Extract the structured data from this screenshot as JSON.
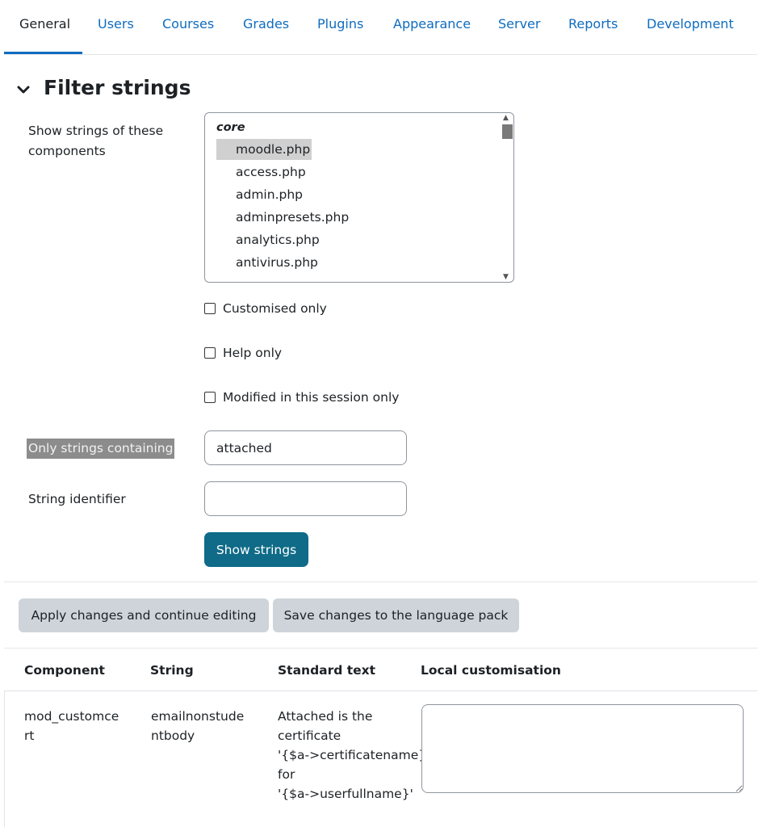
{
  "tabs": [
    {
      "label": "General",
      "active": true
    },
    {
      "label": "Users"
    },
    {
      "label": "Courses"
    },
    {
      "label": "Grades"
    },
    {
      "label": "Plugins"
    },
    {
      "label": "Appearance"
    },
    {
      "label": "Server"
    },
    {
      "label": "Reports"
    },
    {
      "label": "Development"
    }
  ],
  "filter": {
    "title": "Filter strings",
    "components_label": "Show strings of these components",
    "components_group": "core",
    "components_options": [
      "moodle.php",
      "access.php",
      "admin.php",
      "adminpresets.php",
      "analytics.php",
      "antivirus.php"
    ],
    "components_selected": "moodle.php",
    "customised_only": "Customised only",
    "help_only": "Help only",
    "modified_only": "Modified in this session only",
    "substring_label": "Only strings containing",
    "substring_value": "attached",
    "identifier_label": "String identifier",
    "identifier_value": "",
    "show_button": "Show strings"
  },
  "actions": {
    "apply": "Apply changes and continue editing",
    "save": "Save changes to the language pack"
  },
  "table": {
    "headers": [
      "Component",
      "String",
      "Standard text",
      "Local customisation"
    ],
    "rows": [
      {
        "component_lines": [
          "mod_customce",
          "rt"
        ],
        "string_lines": [
          "emailnonstude",
          "ntbody"
        ],
        "standard_lines": [
          "Attached is the",
          "certificate",
          "'{$a->certificatename}'",
          "for",
          "'{$a->userfullname}'"
        ],
        "local": ""
      }
    ]
  },
  "colors": {
    "link": "#0f6cbf",
    "primary_button": "#0f6b87",
    "secondary_button": "#ced4da",
    "highlight": "#8c8c8c"
  }
}
